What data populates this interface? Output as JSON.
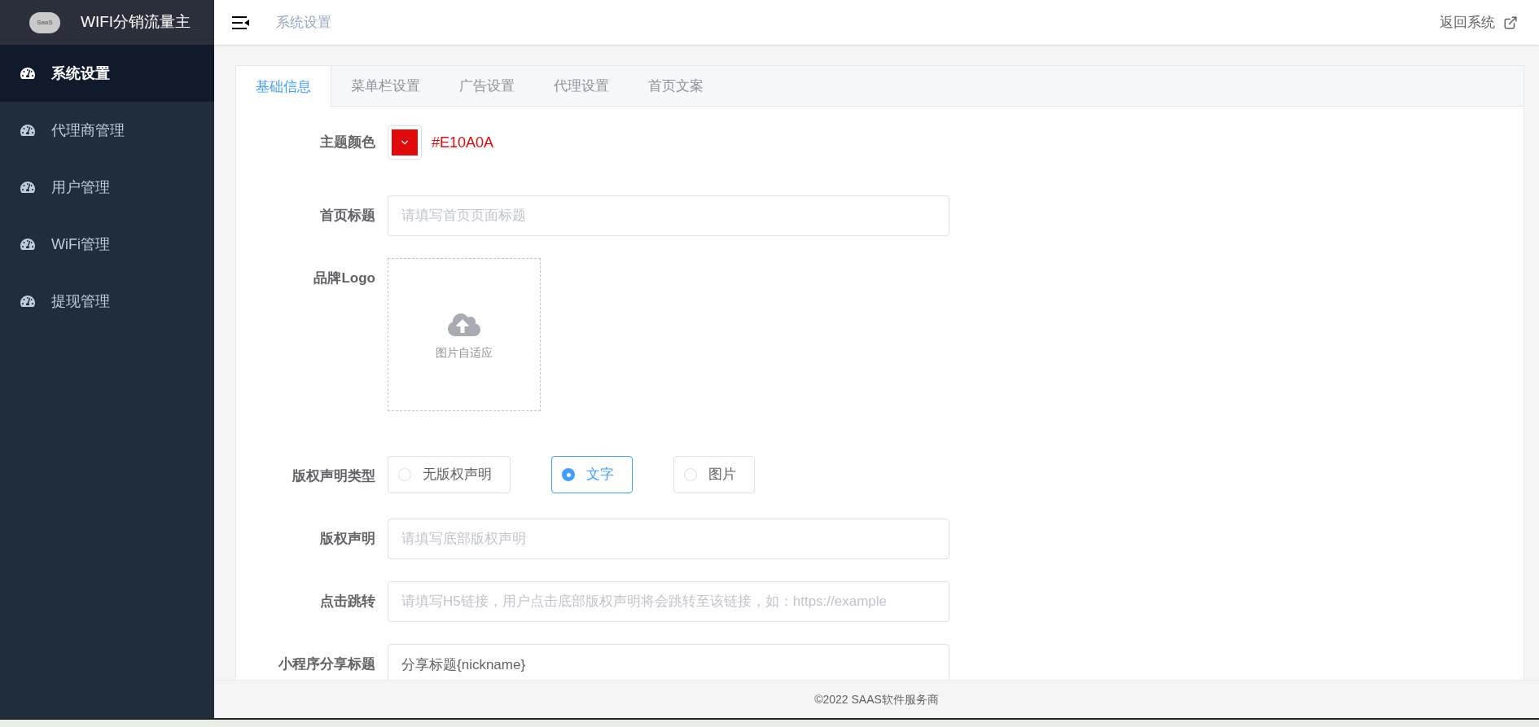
{
  "sidebar": {
    "logo_text": "SaaS",
    "title": "WIFI分销流量主",
    "items": [
      {
        "label": "系统设置",
        "selected": true
      },
      {
        "label": "代理商管理",
        "selected": false
      },
      {
        "label": "用户管理",
        "selected": false
      },
      {
        "label": "WiFi管理",
        "selected": false
      },
      {
        "label": "提现管理",
        "selected": false
      }
    ]
  },
  "header": {
    "breadcrumb": "系统设置",
    "return_link": "返回系统"
  },
  "tabs": [
    {
      "label": "基础信息",
      "selected": true
    },
    {
      "label": "菜单栏设置",
      "selected": false
    },
    {
      "label": "广告设置",
      "selected": false
    },
    {
      "label": "代理设置",
      "selected": false
    },
    {
      "label": "首页文案",
      "selected": false
    }
  ],
  "form": [
    {
      "kind": "color",
      "label": "主题颜色",
      "value": "#E10A0A",
      "color": "#e10a0a"
    },
    {
      "kind": "input",
      "label": "首页标题",
      "placeholder": "请填写首页页面标题"
    },
    {
      "kind": "upload",
      "label": "品牌Logo",
      "hint": "图片自适应"
    },
    {
      "kind": "radio",
      "label": "版权声明类型",
      "options": [
        {
          "label": "无版权声明",
          "selected": false
        },
        {
          "label": "文字",
          "selected": true
        },
        {
          "label": "图片",
          "selected": false
        }
      ]
    },
    {
      "kind": "input",
      "label": "版权声明",
      "placeholder": "请填写底部版权声明"
    },
    {
      "kind": "input",
      "label": "点击跳转",
      "placeholder": "请填写H5链接，用户点击底部版权声明将会跳转至该链接，如：https://example"
    },
    {
      "kind": "input",
      "label": "小程序分享标题",
      "value": "分享标题{nickname}"
    }
  ],
  "footer": "©2022 SAAS软件服务商"
}
